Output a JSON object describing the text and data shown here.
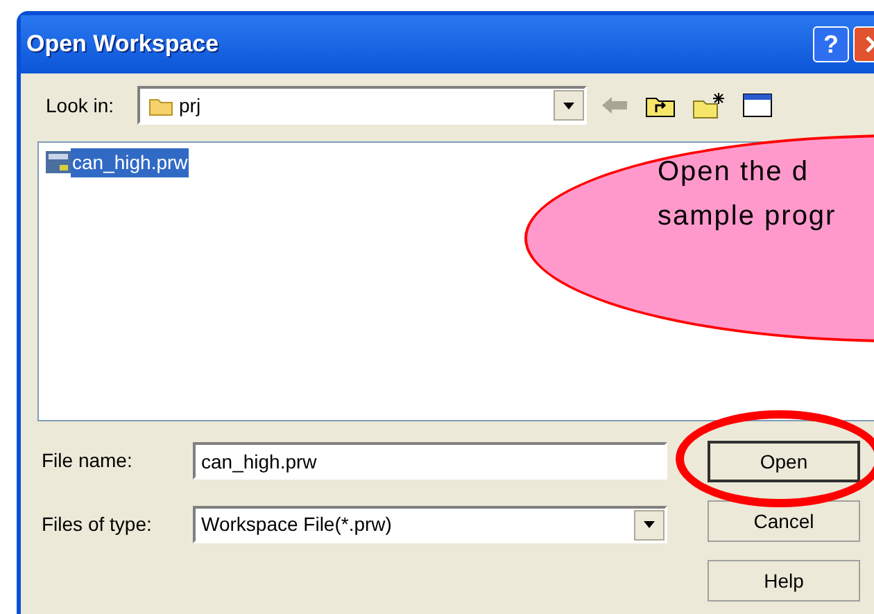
{
  "window": {
    "title": "Open Workspace",
    "help": "?"
  },
  "look_in": {
    "label": "Look in:",
    "value": "prj"
  },
  "files": [
    {
      "name": "can_high.prw",
      "selected": true
    }
  ],
  "file_name": {
    "label": "File name:",
    "value": "can_high.prw"
  },
  "file_type": {
    "label": "Files of type:",
    "value": "Workspace File(*.prw)"
  },
  "buttons": [
    {
      "label": "Open",
      "default": true
    },
    {
      "label": "Cancel",
      "default": false
    },
    {
      "label": "Help",
      "default": false
    }
  ],
  "callout": {
    "lines": [
      "Open the d",
      "sample progr"
    ]
  }
}
